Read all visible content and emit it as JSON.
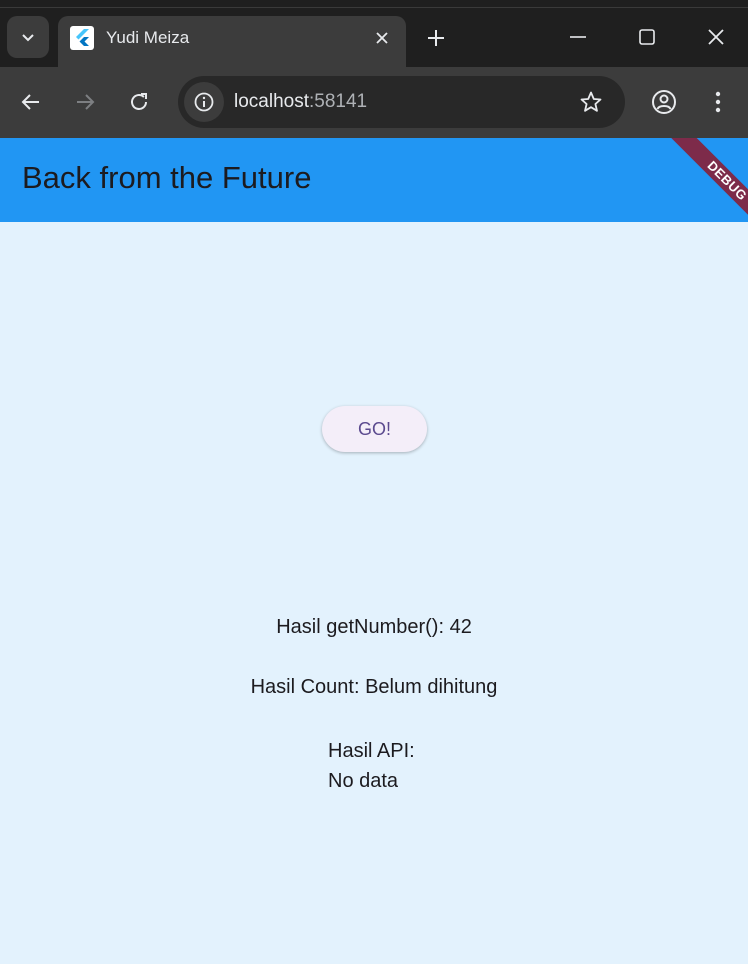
{
  "browser": {
    "tab_title": "Yudi Meiza",
    "url_host": "localhost",
    "url_port": ":58141"
  },
  "app": {
    "title": "Back from the Future",
    "debug_banner": "DEBUG",
    "go_button": "GO!",
    "results": {
      "number": "Hasil getNumber(): 42",
      "count": "Hasil Count: Belum dihitung",
      "api_label": "Hasil API:",
      "api_value": "No data"
    }
  },
  "colors": {
    "appbar": "#2196f3",
    "background": "#e3f2fd",
    "debug_banner": "#7d2b4a"
  }
}
